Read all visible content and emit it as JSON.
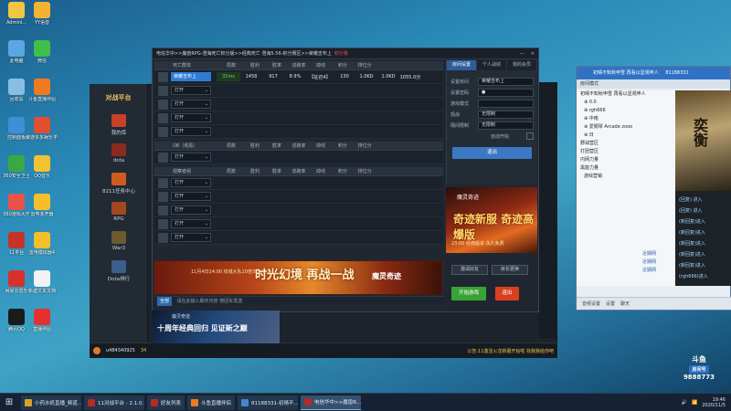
{
  "desktop": {
    "icons": [
      {
        "label": "Admini...",
        "color": "#f4c542"
      },
      {
        "label": "YY语音",
        "color": "#f2b233"
      },
      {
        "label": "此电脑",
        "color": "#5aa8e0"
      },
      {
        "label": "微信",
        "color": "#3fbf4a"
      },
      {
        "label": "回收站",
        "color": "#8bbde3"
      },
      {
        "label": "斗鱼直播伴侣",
        "color": "#f07a1f"
      },
      {
        "label": "控制面板",
        "color": "#3d8fd6"
      },
      {
        "label": "聚游多多娱乐平台",
        "color": "#e44d2e"
      },
      {
        "label": "360安全卫士",
        "color": "#3aa843"
      },
      {
        "label": "QQ音乐",
        "color": "#f1c330"
      },
      {
        "label": "360游戏大厅",
        "color": "#e9534c"
      },
      {
        "label": "雷电多开器",
        "color": "#f4bf2a"
      },
      {
        "label": "11平台",
        "color": "#c73227"
      },
      {
        "label": "雷电模拟器4",
        "color": "#f4bf2a"
      },
      {
        "label": "网易云音乐",
        "color": "#d8302c"
      },
      {
        "label": "新建文本文档",
        "color": "#f2f2f2"
      },
      {
        "label": "腾讯QQ",
        "color": "#1b1b1b"
      },
      {
        "label": "直播伴侣",
        "color": "#e5302f"
      }
    ]
  },
  "client": {
    "logo": "对战平台",
    "side_items": [
      {
        "label": "我的库",
        "color": "#c8402a"
      },
      {
        "label": "dota",
        "color": "#8a2a20"
      },
      {
        "label": "8211任务中心",
        "color": "#d05a1f"
      },
      {
        "label": "RPG",
        "color": "#a4461f"
      },
      {
        "label": "War3",
        "color": "#6e5a2f"
      },
      {
        "label": "Dota排行",
        "color": "#3a5f8a"
      }
    ],
    "bottom": {
      "user": "u484340925",
      "level": "34",
      "scroll": "公告:11激活火龙新服开始啦 找我我给你吧"
    }
  },
  "room": {
    "title": "电信华中>>魔兽RPG-澄海死亡积分版>>经典死亡 澄海5.56-积分赛区>>荣耀吉布上",
    "title_new": "积分赛",
    "columns": [
      "局数",
      "胜利",
      "胜率",
      "逃跑率",
      "掉线",
      "积分",
      "排位分"
    ],
    "teams": [
      {
        "name": "死亡群体",
        "seats": [
          {
            "filled": true,
            "name": "荣耀吉布上",
            "ping": "31ms",
            "stats": [
              "1458",
              "917",
              "8.9%",
              "【征召4】",
              "130",
              "1.0KD",
              "1.0KD",
              "1055.0分"
            ]
          },
          {
            "filled": false,
            "label": "打开"
          },
          {
            "filled": false,
            "label": "打开"
          },
          {
            "filled": false,
            "label": "打开"
          },
          {
            "filled": false,
            "label": "打开"
          }
        ]
      },
      {
        "name": "OB（观看）",
        "seats": [
          {
            "filled": false,
            "label": "打开"
          }
        ]
      },
      {
        "name": "观察者组",
        "seats": [
          {
            "filled": false,
            "label": "打开"
          },
          {
            "filled": false,
            "label": "打开"
          },
          {
            "filled": false,
            "label": "打开"
          },
          {
            "filled": false,
            "label": "打开"
          },
          {
            "filled": false,
            "label": "打开"
          }
        ]
      }
    ],
    "banner": {
      "headline": "时光幻境 再战一战",
      "date": "11月4日14:00 攻城大队10倍单人副本",
      "brand": "魔灵奇迹"
    },
    "chat": {
      "channel": "全部",
      "placeholder": "请在此输入聊天内容 按回车发送"
    },
    "settings": {
      "tabs": [
        "房间设置",
        "个人战绩",
        "我的会员"
      ],
      "rows": [
        {
          "key": "设置房间",
          "value": "荣耀吉布上"
        },
        {
          "key": "设置密码",
          "value": "●"
        },
        {
          "key": "游戏模式",
          "value": ""
        },
        {
          "key": "观战",
          "value": "无限制"
        },
        {
          "key": "隔间限制",
          "value": "无限制"
        }
      ],
      "auto_label": "自动开始",
      "leave": "退出"
    },
    "side_banner": {
      "title": "魔灵奇迹",
      "headline": "奇迹新服 奇迹高爆版",
      "sub": "23:00 经典版本 永久免费"
    },
    "actions": {
      "invite": "邀请好友",
      "leader": "房长更换",
      "start": "开始游戏",
      "quit": "退出"
    }
  },
  "bottom_banner": {
    "headline": "十周年经典回归 见证新之巅",
    "brand": "魔灵奇迹"
  },
  "stream": {
    "title": "初晴不知秋申雪 再看以显观申人",
    "room_id": "81188331",
    "channel": "房间模式",
    "tree": [
      {
        "text": "初晴不知秋申雪 再看以显观申人",
        "root": true
      },
      {
        "text": "⊕ 0.0 ",
        "root": false
      },
      {
        "text": "⊕ rgh666 ",
        "root": false
      },
      {
        "text": "⊕ 中南 ",
        "root": false
      },
      {
        "text": "⊕ 爱钢琴 Arcade zooo",
        "root": false
      },
      {
        "text": "⊕ 日 ",
        "root": false
      },
      {
        "text": "野战营区",
        "root": true
      },
      {
        "text": "打团营区",
        "root": true
      },
      {
        "text": "内网力量",
        "root": true
      },
      {
        "text": "黑能力量",
        "root": true
      },
      {
        "text": "游戏营销",
        "root": false
      }
    ],
    "tree_tags": [
      "近期网",
      "近期网",
      "近期网"
    ],
    "art_text": "奕衡",
    "messages": [
      "(回复) 进入",
      "(回复) 进入",
      "(新回复)进入",
      "(新回复)进入",
      "(新回复)进入",
      "(新回复)进入",
      "(新回复)进入",
      "(rgh666)进入"
    ],
    "bottom": [
      "音频设置",
      "设置",
      "聊天"
    ]
  },
  "douyu": {
    "brand": "斗鱼",
    "label": "房间号",
    "number": "9888773"
  },
  "taskbar": {
    "tasks": [
      {
        "label": "小药水机直播_频道...",
        "color": "#d8a12c",
        "active": false
      },
      {
        "label": "11对战平台 - 2.1.0.1",
        "color": "#b52a22",
        "active": false
      },
      {
        "label": "好友列表",
        "color": "#b52a22",
        "active": false
      },
      {
        "label": "斗鱼直播伴侣",
        "color": "#f07a1f",
        "active": false
      },
      {
        "label": "81188331-初晴不...",
        "color": "#4a84c9",
        "active": false
      },
      {
        "label": "电信华中>>魔兽R...",
        "color": "#b52a22",
        "active": true
      }
    ],
    "time": "19:46",
    "date": "2020/11/5"
  }
}
